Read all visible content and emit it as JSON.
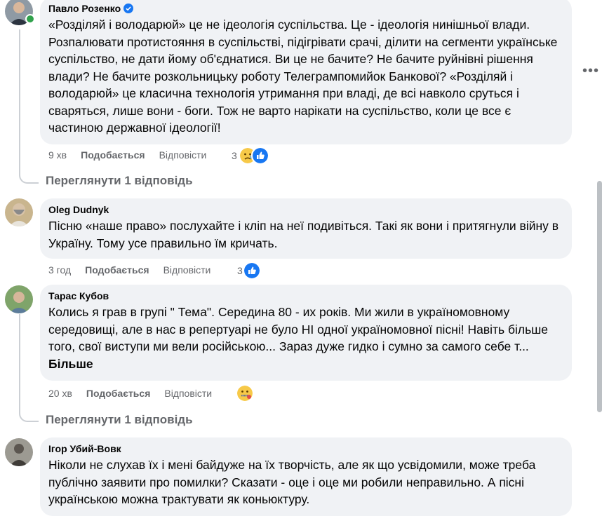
{
  "comments": [
    {
      "author": "Павло Розенко",
      "verified": true,
      "online": true,
      "text": "«Розділяй і володарюй» це не ідеологія суспільства. Це - ідеологія нинішньої влади. Розпалювати протистояння в суспільстві, підігрівати срачі, ділити на сегменти українське суспільство, не дати йому об'єднатися. Ви це не бачите? Не бачите руйнівні рішення влади? Не бачите розкольницьку роботу Телегрампомийок Банкової? «Розділяй і володарюй» це класична технологія утримання при владі, де всі навколо сруться і сваряться, лише вони - боги. Тож не варто нарікати на суспільство, коли це все є частиною державної ідеології!",
      "time": "9 хв",
      "like_label": "Подобається",
      "reply_label": "Відповісти",
      "reaction_count": "3",
      "reactions": [
        "sad-face",
        "like-thumb"
      ],
      "view_replies": "Переглянути 1 відповідь"
    },
    {
      "author": "Oleg Dudnyk",
      "text": "Пісню «наше право» послухайте і кліп на неї подивіться. Такі як вони і притягнули війну в Україну. Тому усе правильно їм кричать.",
      "time": "3 год",
      "like_label": "Подобається",
      "reply_label": "Відповісти",
      "reaction_count": "3",
      "reactions": [
        "like-thumb"
      ]
    },
    {
      "author": "Тарас Кубов",
      "text": "Колись я грав в групі \" Тема\". Середина 80 - их років. Ми жили в україномовному середовищі, але в нас в репертуарі не було НІ одної україномовної пісні! Навіть більше того, свої виступи ми вели російською... Зараз дуже гидко і сумно за самого себе т...",
      "more_label": "Більше",
      "time": "20 хв",
      "like_label": "Подобається",
      "reply_label": "Відповісти",
      "reactions": [
        "zipper-mouth-face"
      ],
      "view_replies": "Переглянути 1 відповідь"
    },
    {
      "author": "Ігор Убий-Вовк",
      "text": "Ніколи не слухав їх і мені байдуже на їх творчість, але як що усвідомили, може треба публічно заявити про помилки? Сказати - оце і оце ми робили неправильно. А пісні українською можна трактувати як коньюктуру."
    }
  ],
  "icons": {
    "more": "more-options-icon",
    "verified": "verified-badge-icon"
  },
  "colors": {
    "bubble": "#f0f2f5",
    "secondary_text": "#65676b",
    "like_blue": "#1877f2",
    "online": "#31a24c"
  }
}
